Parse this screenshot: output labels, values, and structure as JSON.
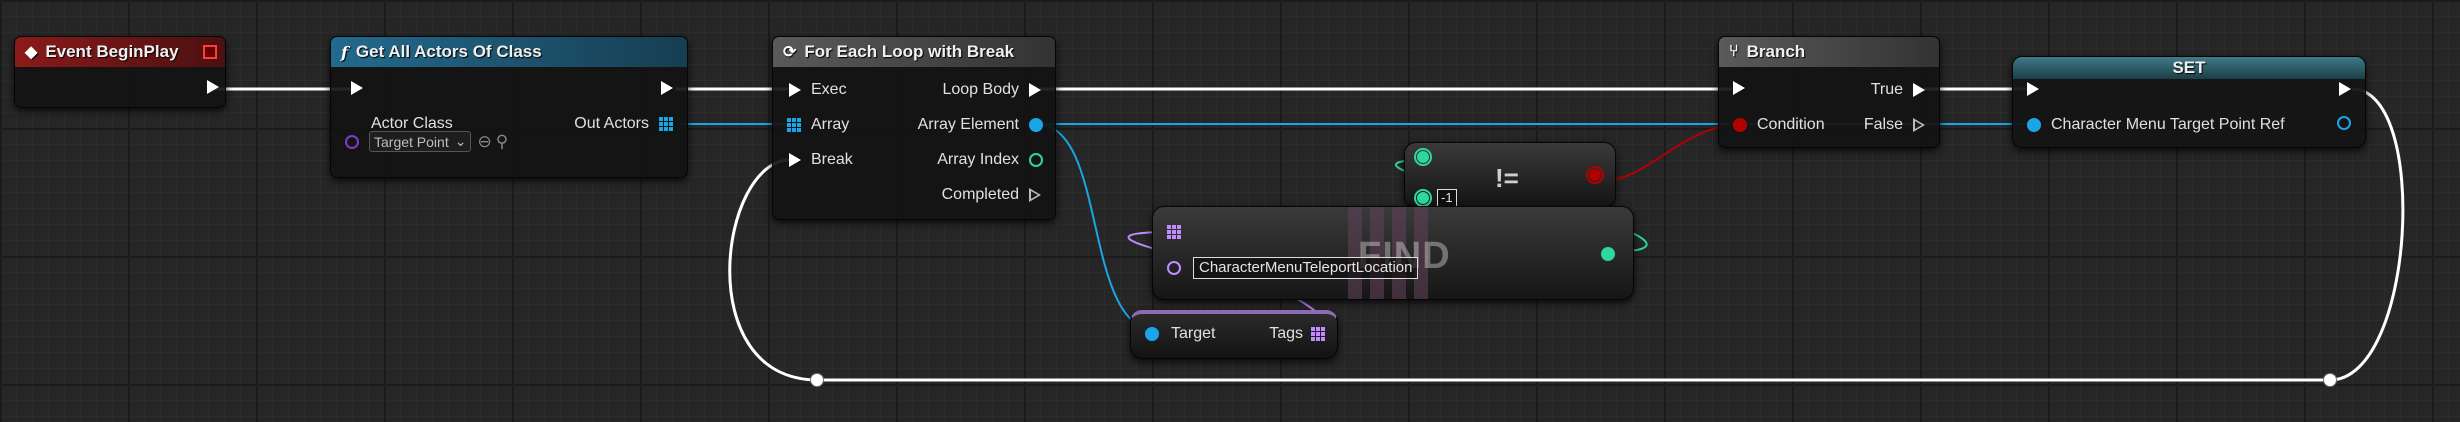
{
  "nodes": {
    "begin_play": {
      "title": "Event BeginPlay",
      "header_color": "#8c1a1a"
    },
    "get_all_actors": {
      "title": "Get All Actors Of Class",
      "icon": "function-icon",
      "header_color": "#1f5a7a",
      "inputs": {
        "actor_class": "Actor Class",
        "actor_class_value": "Target Point"
      },
      "outputs": {
        "out_actors": "Out Actors"
      }
    },
    "for_each": {
      "title": "For Each Loop with Break",
      "icon": "loop-icon",
      "header_color": "#4a4a4a",
      "inputs": {
        "exec": "Exec",
        "array": "Array",
        "break": "Break"
      },
      "outputs": {
        "loop_body": "Loop Body",
        "array_element": "Array Element",
        "array_index": "Array Index",
        "completed": "Completed"
      }
    },
    "branch": {
      "title": "Branch",
      "icon": "branch-icon",
      "header_color": "#4a4a4a",
      "inputs": {
        "condition": "Condition"
      },
      "outputs": {
        "true": "True",
        "false": "False"
      }
    },
    "set_node": {
      "title": "SET",
      "header_color": "#2e5a66",
      "variable": "Character Menu Target Point Ref"
    },
    "not_equal": {
      "operator": "!=",
      "right_value": "-1"
    },
    "find": {
      "watermark": "FIND",
      "value": "CharacterMenuTeleportLocation"
    },
    "tags_getter": {
      "input": "Target",
      "output": "Tags"
    }
  },
  "colors": {
    "exec": "#ffffff",
    "object": "#1aa6e6",
    "integer": "#2fd6a0",
    "boolean": "#b30000",
    "name": "#c28bff",
    "class": "#7b3cc8"
  }
}
